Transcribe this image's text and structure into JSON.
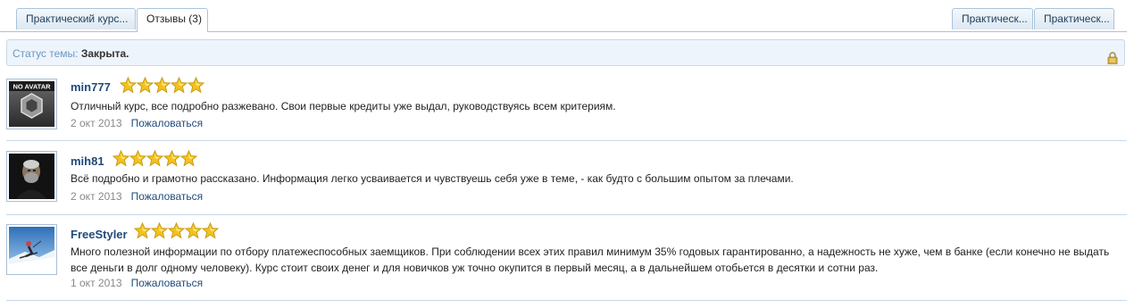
{
  "tabs": {
    "left": [
      {
        "label": "Практический курс..."
      },
      {
        "label": "Отзывы (3)",
        "active": true
      }
    ],
    "right": [
      {
        "label": "Практическ..."
      },
      {
        "label": "Практическ..."
      }
    ]
  },
  "status": {
    "label": "Статус темы:",
    "value": "Закрыта.",
    "icon": "lock-icon"
  },
  "reviews": [
    {
      "author": "min777",
      "avatar": "no-avatar",
      "avatar_text": "NO AVATAR",
      "rating": 5,
      "text": "Отличный курс, все подробно разжевано. Свои первые кредиты уже выдал, руководствуясь всем критериям.",
      "date": "2 окт 2013",
      "report_label": "Пожаловаться"
    },
    {
      "author": "mih81",
      "avatar": "photo-man",
      "rating": 5,
      "text": "Всё подробно и грамотно рассказано. Информация легко усваивается и чувствуешь себя уже в теме, - как будто с большим опытом за плечами.",
      "date": "2 окт 2013",
      "report_label": "Пожаловаться"
    },
    {
      "author": "FreeStyler",
      "avatar": "photo-skier",
      "rating": 5,
      "text": "Много полезной информации по отбору платежеспособных заемщиков. При соблюдении всех этих правил минимум 35% годовых гарантированно, а надежность не хуже, чем в банке (если конечно не выдать все деньги в долг одному человеку). Курс стоит своих денег и для новичков уж точно окупится в первый месяц, а в дальнейшем отобьется в десятки и сотни раз.",
      "date": "1 окт 2013",
      "report_label": "Пожаловаться"
    }
  ],
  "colors": {
    "link": "#1f4a7a",
    "status_label": "#6b97c2",
    "border": "#a9c4dc",
    "star": "#f5c21b"
  }
}
